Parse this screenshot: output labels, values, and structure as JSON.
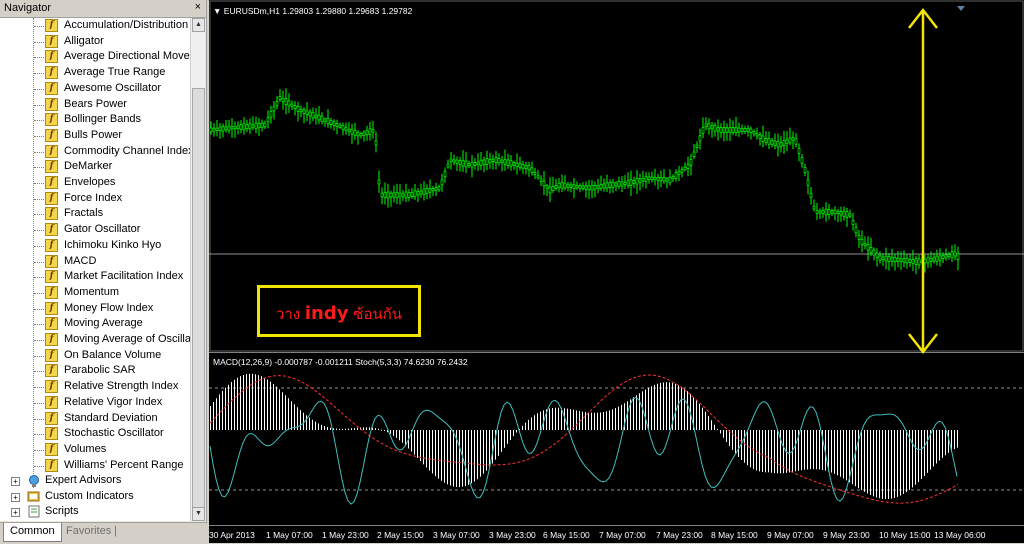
{
  "navigator": {
    "title": "Navigator",
    "close": "×",
    "indicators": [
      "Accumulation/Distribution",
      "Alligator",
      "Average Directional Movem",
      "Average True Range",
      "Awesome Oscillator",
      "Bears Power",
      "Bollinger Bands",
      "Bulls Power",
      "Commodity Channel Index",
      "DeMarker",
      "Envelopes",
      "Force Index",
      "Fractals",
      "Gator Oscillator",
      "Ichimoku Kinko Hyo",
      "MACD",
      "Market Facilitation Index",
      "Momentum",
      "Money Flow Index",
      "Moving Average",
      "Moving Average of Oscillat",
      "On Balance Volume",
      "Parabolic SAR",
      "Relative Strength Index",
      "Relative Vigor Index",
      "Standard Deviation",
      "Stochastic Oscillator",
      "Volumes",
      "Williams' Percent Range"
    ],
    "indicator_icon": "f",
    "groups": [
      "Expert Advisors",
      "Custom Indicators",
      "Scripts"
    ],
    "tabs": {
      "common": "Common",
      "favorites": "Favorites",
      "sep": "|"
    }
  },
  "chart": {
    "header": "EURUSDm,H1  1.29803 1.29880 1.29683 1.29782",
    "subwindow_header": "MACD(12,26,9) -0.000787 -0.001211  Stoch(5,3,3) 74.6230 76.2432",
    "annotation": {
      "prefix": "วาง",
      "bold": "indy",
      "suffix": "ซ้อนกัน"
    },
    "x_labels": [
      "30 Apr 2013",
      "1 May 07:00",
      "1 May 23:00",
      "2 May 15:00",
      "3 May 07:00",
      "3 May 23:00",
      "6 May 15:00",
      "7 May 07:00",
      "7 May 23:00",
      "8 May 15:00",
      "9 May 07:00",
      "9 May 23:00",
      "10 May 15:00",
      "13 May 06:00"
    ],
    "colors": {
      "candles": "#00ff00",
      "macd": "#ffffff",
      "signal": "#ff3030",
      "stoch_main": "#40c0c0",
      "annotation_box": "#f2e600",
      "annotation_text": "#ff1a1a",
      "arrow": "#f2e600"
    }
  }
}
